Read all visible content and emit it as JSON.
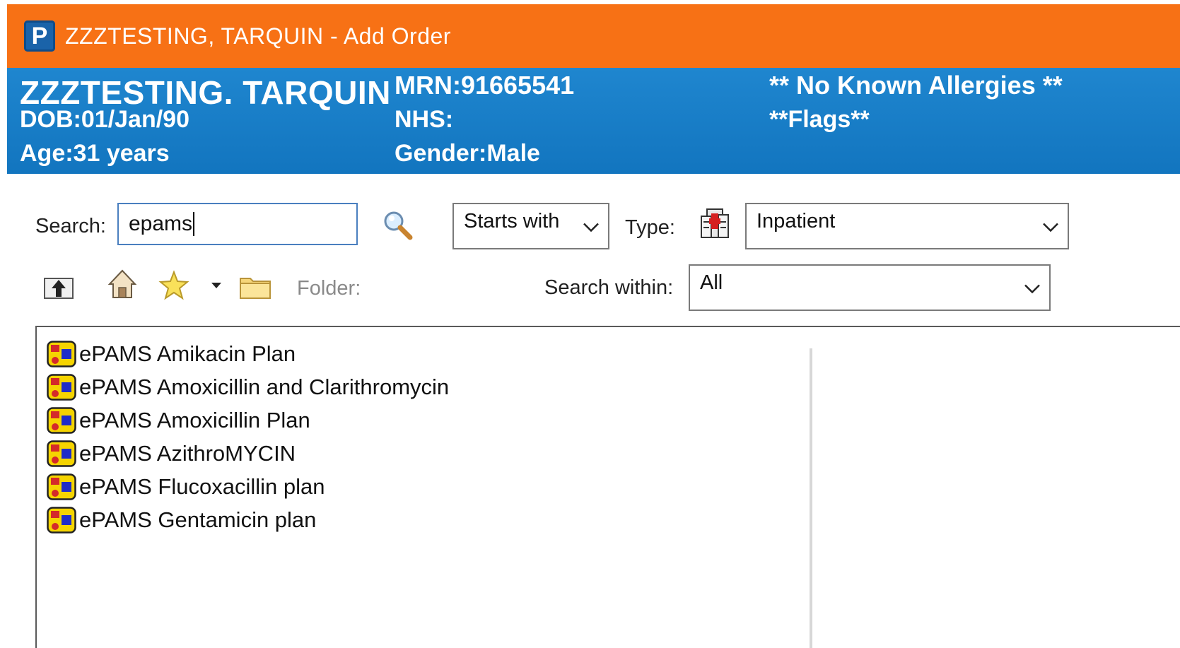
{
  "window": {
    "title": "ZZZTESTING, TARQUIN  - Add Order",
    "app_letter": "P"
  },
  "patient": {
    "name": "ZZZTESTING. TARQUIN",
    "dob": "DOB:01/Jan/90",
    "age": "Age:31 years",
    "mrn": "MRN:91665541",
    "nhs": "NHS:",
    "gender": "Gender:Male",
    "allergies": "** No Known Allergies **",
    "flags": "**Flags**"
  },
  "search": {
    "label": "Search:",
    "value": "epams",
    "mode": "Starts with",
    "type_label": "Type:",
    "type_value": "Inpatient",
    "folder_label": "Folder:",
    "within_label": "Search within:",
    "within_value": "All"
  },
  "results": [
    {
      "label": "ePAMS Amikacin Plan"
    },
    {
      "label": "ePAMS Amoxicillin and Clarithromycin"
    },
    {
      "label": "ePAMS Amoxicillin Plan"
    },
    {
      "label": "ePAMS AzithroMYCIN"
    },
    {
      "label": "ePAMS Flucoxacillin plan"
    },
    {
      "label": "ePAMS Gentamicin plan"
    }
  ],
  "colors": {
    "titlebar": "#f77115",
    "banner": "#1275bf"
  }
}
